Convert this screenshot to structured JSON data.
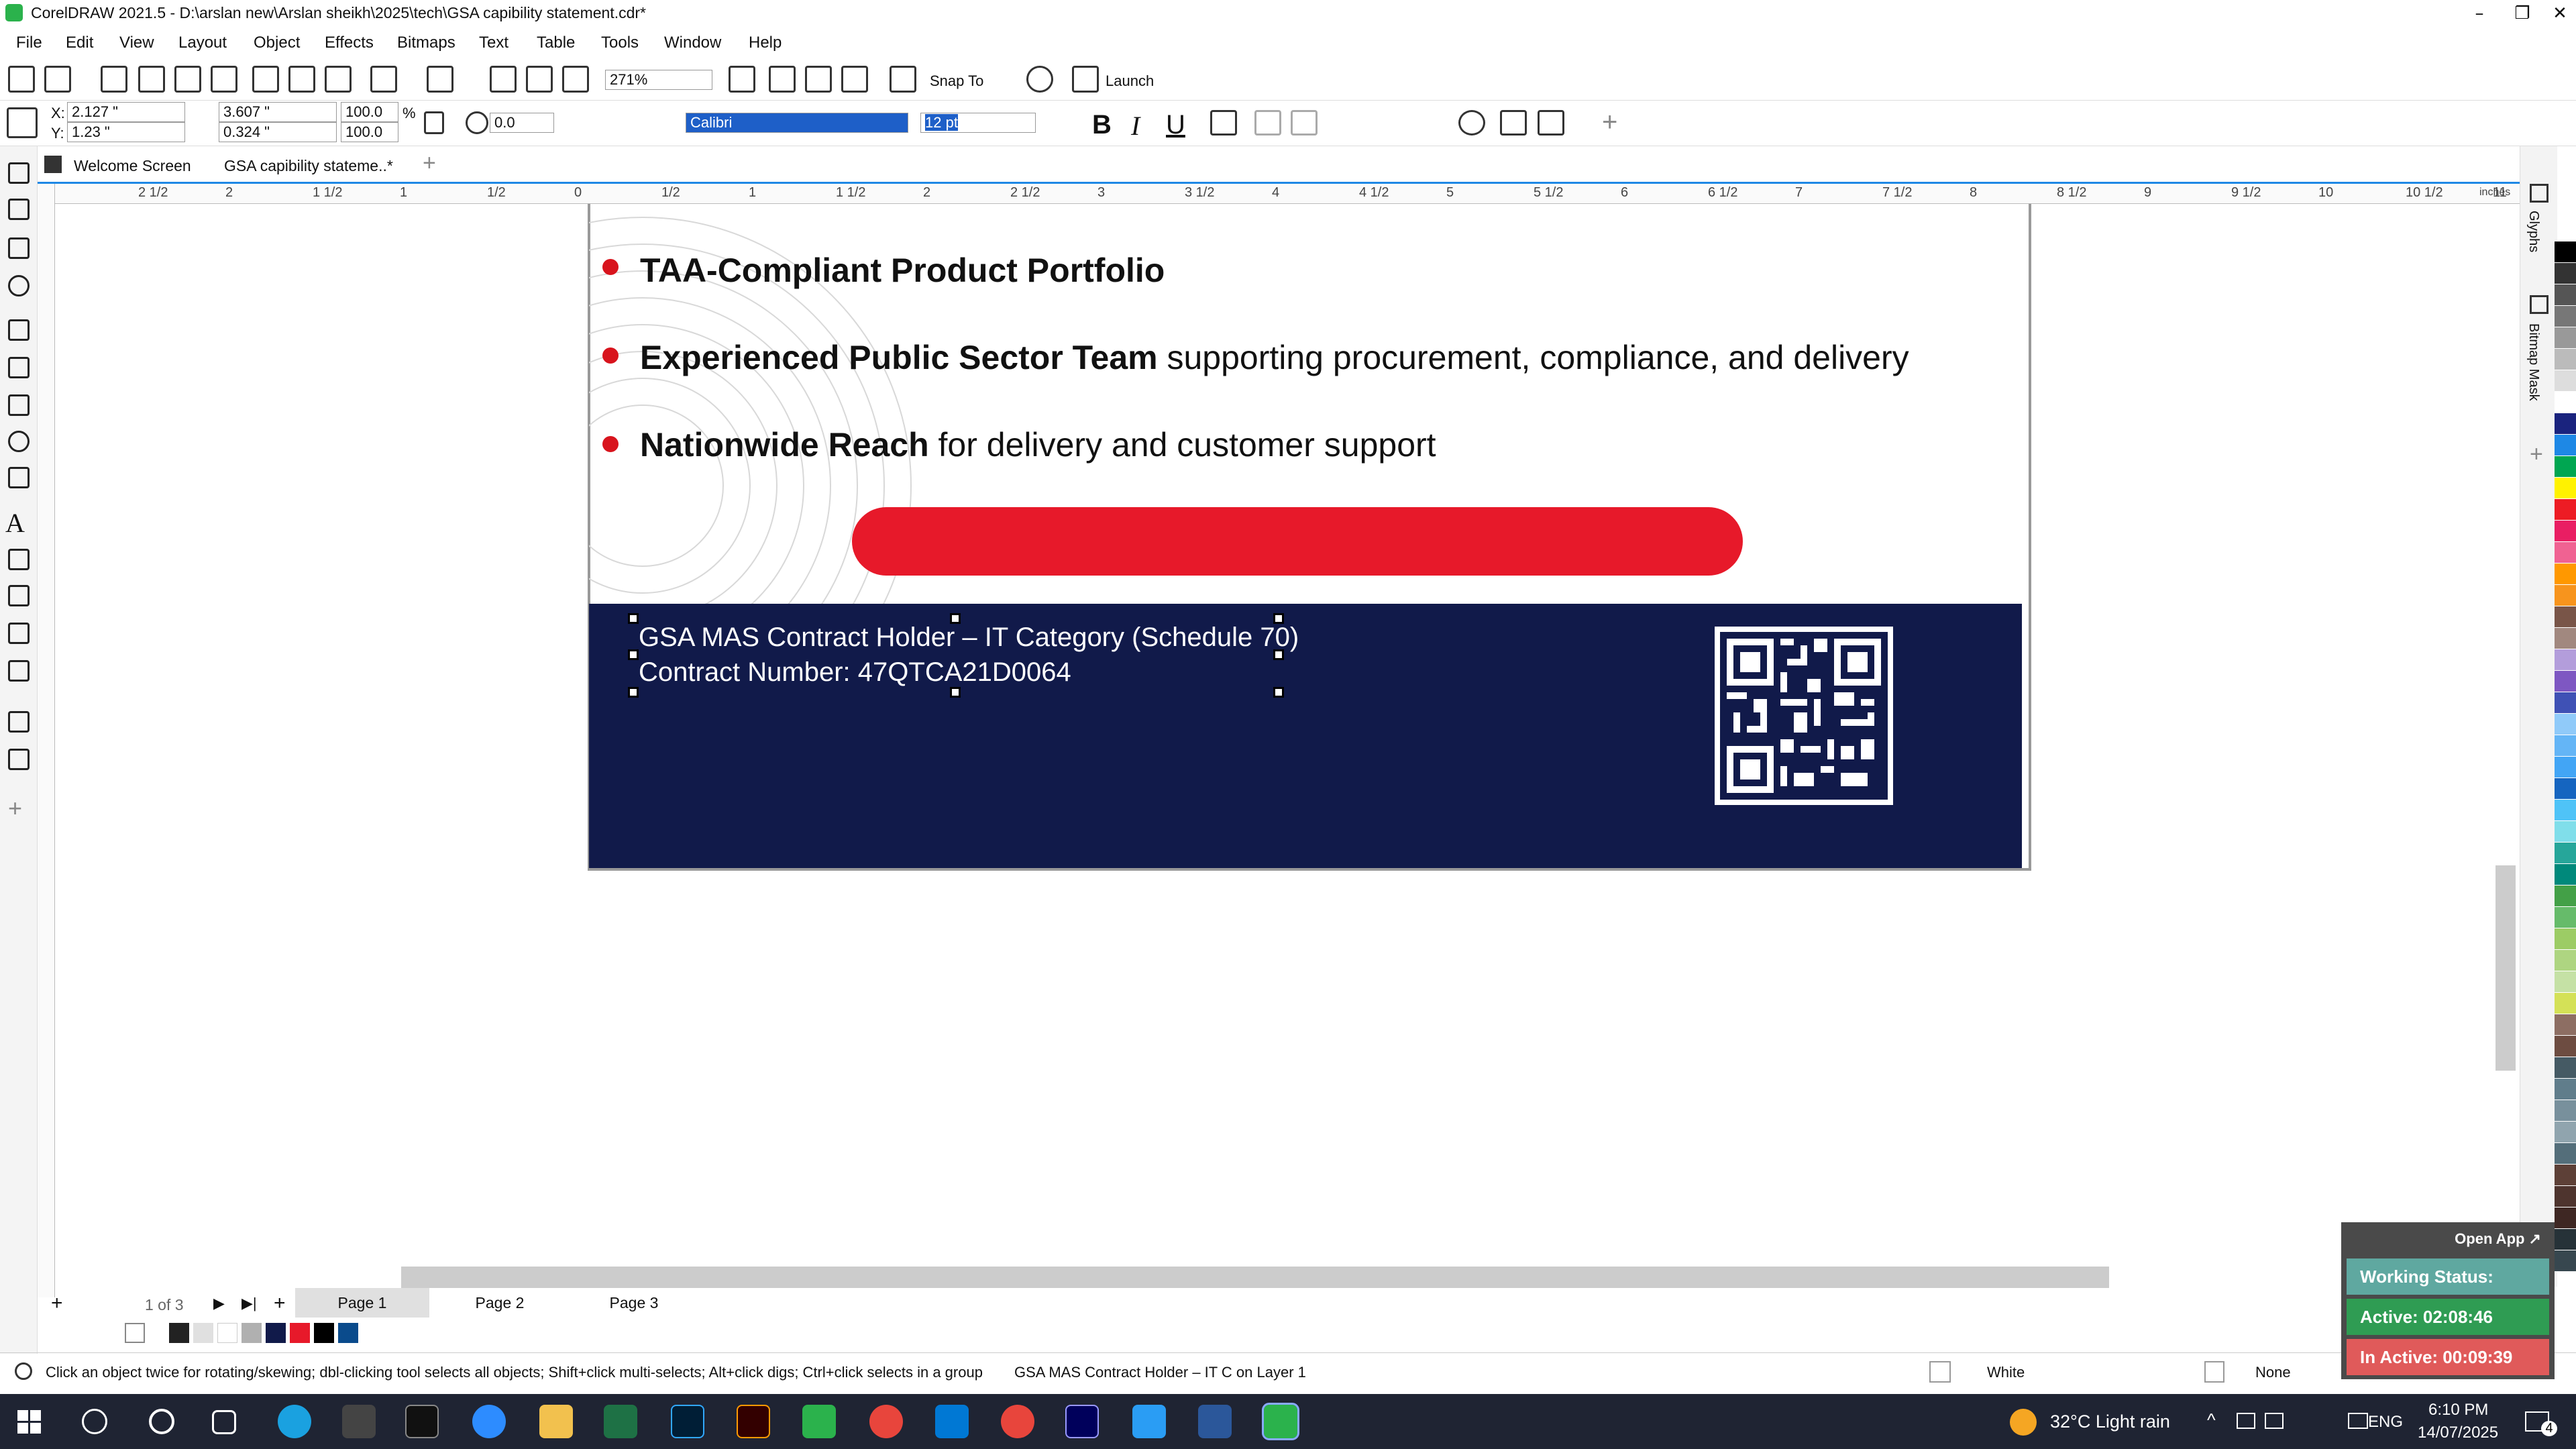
{
  "window": {
    "title": "CorelDRAW 2021.5 - D:\\arslan new\\Arslan sheikh\\2025\\tech\\GSA  capibility statement.cdr*"
  },
  "menu": [
    "File",
    "Edit",
    "View",
    "Layout",
    "Object",
    "Effects",
    "Bitmaps",
    "Text",
    "Table",
    "Tools",
    "Window",
    "Help"
  ],
  "toolbar": {
    "zoom": "271%",
    "snap_to": "Snap To",
    "launch": "Launch"
  },
  "propbar": {
    "x_label": "X:",
    "x": "2.127 \"",
    "y_label": "Y:",
    "y": "1.23 \"",
    "w": "3.607 \"",
    "h": "0.324 \"",
    "scale_w": "100.0",
    "scale_h": "100.0",
    "pct": "%",
    "angle": "0.0",
    "font": "Calibri",
    "size": "12 pt"
  },
  "tabs": [
    "Welcome Screen",
    "GSA  capibility stateme..*"
  ],
  "ruler": {
    "unit": "inches",
    "labels": [
      "2 1/2",
      "2",
      "1 1/2",
      "1",
      "1/2",
      "0",
      "1/2",
      "1",
      "1 1/2",
      "2",
      "2 1/2",
      "3",
      "3 1/2",
      "4",
      "4 1/2",
      "5",
      "5 1/2",
      "6",
      "6 1/2",
      "7",
      "7 1/2",
      "8",
      "8 1/2",
      "9",
      "9 1/2",
      "10",
      "10 1/2",
      "11"
    ]
  },
  "document": {
    "bullets": [
      {
        "bold": "TAA-Compliant Product Portfolio",
        "rest": ""
      },
      {
        "bold": "Experienced Public Sector Team",
        "rest": " supporting procurement, compliance, and delivery"
      },
      {
        "bold": "Nationwide Reach",
        "rest": " for delivery and customer support"
      }
    ],
    "footer_line1": "GSA MAS Contract Holder – IT Category (Schedule 70)",
    "footer_line2": "Contract Number: 47QTCA21D0064"
  },
  "pages": {
    "count": "1 of 3",
    "tabs": [
      "Page 1",
      "Page 2",
      "Page 3"
    ]
  },
  "status": {
    "hint": "Click an object twice for rotating/skewing; dbl-clicking tool selects all objects; Shift+click multi-selects; Alt+click digs; Ctrl+click selects in a group",
    "selection": "GSA MAS Contract Holder – IT C on Layer 1",
    "fill": "White",
    "outline": "None"
  },
  "dock": {
    "glyphs": "Glyphs",
    "bitmap_mask": "Bitmap Mask"
  },
  "widget": {
    "open_app": "Open App ↗",
    "working": "Working Status: Active",
    "active": "Active: 02:08:46",
    "inactive": "In Active: 00:09:39"
  },
  "taskbar": {
    "weather": "32°C  Light rain",
    "lang": "ENG",
    "time": "6:10 PM",
    "date": "14/07/2025",
    "notif": "4"
  },
  "colors": {
    "navy": "#111a4a",
    "red": "#e7192a",
    "accent": "#1e88e5"
  }
}
